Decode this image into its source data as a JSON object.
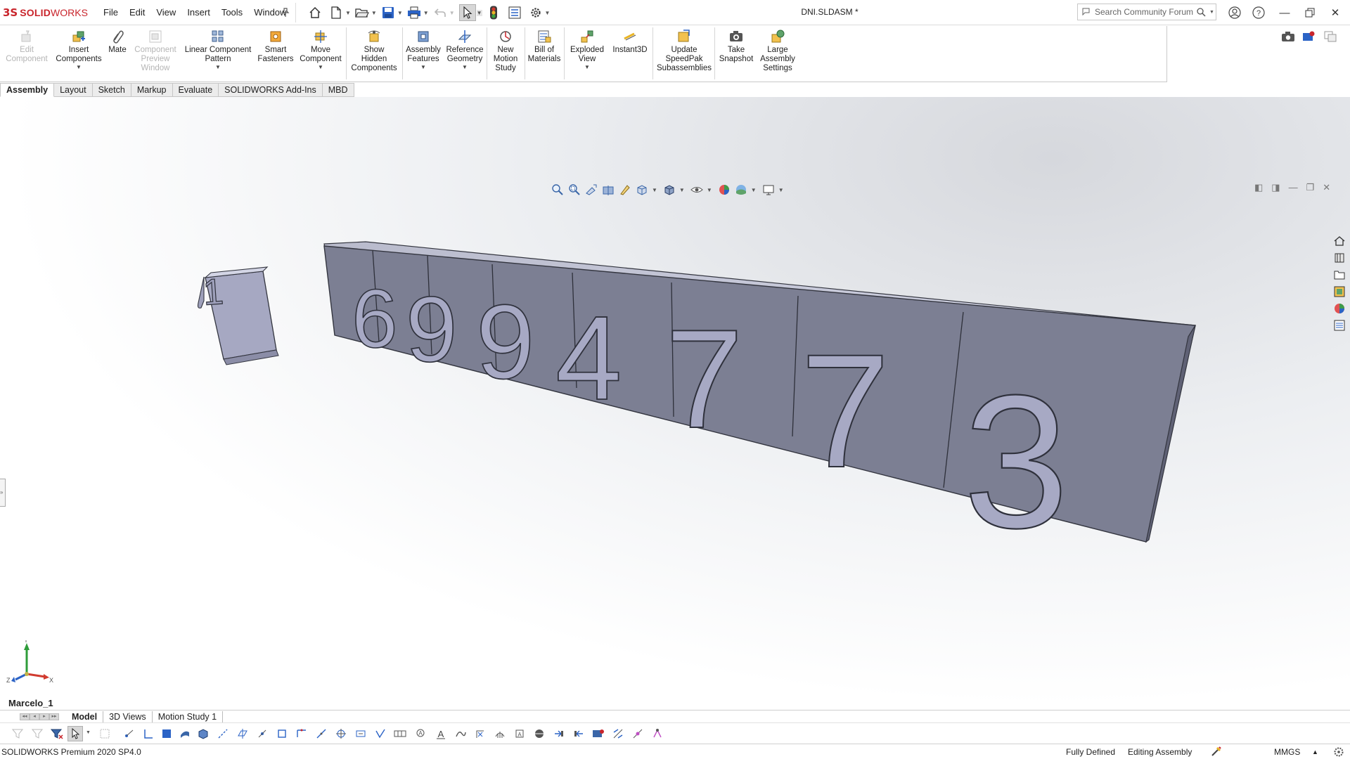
{
  "app": {
    "brand_ds": "3S",
    "brand_solid": "SOLID",
    "brand_works": "WORKS",
    "document_title": "DNI.SLDASM *"
  },
  "menu": [
    "File",
    "Edit",
    "View",
    "Insert",
    "Tools",
    "Window"
  ],
  "search": {
    "placeholder": "Search Community Forum"
  },
  "commands": [
    {
      "label": "Edit\nComponent",
      "enabled": false
    },
    {
      "label": "Insert\nComponents",
      "enabled": true
    },
    {
      "label": "Mate",
      "enabled": true
    },
    {
      "label": "Component\nPreview\nWindow",
      "enabled": false
    },
    {
      "label": "Linear Component\nPattern",
      "enabled": true
    },
    {
      "label": "Smart\nFasteners",
      "enabled": true
    },
    {
      "label": "Move\nComponent",
      "enabled": true
    },
    {
      "label": "Show\nHidden\nComponents",
      "enabled": true
    },
    {
      "label": "Assembly\nFeatures",
      "enabled": true
    },
    {
      "label": "Reference\nGeometry",
      "enabled": true
    },
    {
      "label": "New\nMotion\nStudy",
      "enabled": true
    },
    {
      "label": "Bill of\nMaterials",
      "enabled": true
    },
    {
      "label": "Exploded\nView",
      "enabled": true
    },
    {
      "label": "Instant3D",
      "enabled": true
    },
    {
      "label": "Update\nSpeedPak\nSubassemblies",
      "enabled": true
    },
    {
      "label": "Take\nSnapshot",
      "enabled": true
    },
    {
      "label": "Large\nAssembly\nSettings",
      "enabled": true
    }
  ],
  "command_tabs": [
    "Assembly",
    "Layout",
    "Sketch",
    "Markup",
    "Evaluate",
    "SOLIDWORKS Add-Ins",
    "MBD"
  ],
  "model": {
    "digits": [
      "1",
      "6",
      "9",
      "9",
      "4",
      "7",
      "7",
      "3"
    ],
    "face_color": "#7f8195",
    "top_color": "#c4c6d8",
    "digit_color": "#a9abc6"
  },
  "triad": {
    "x": "X",
    "y": "Y",
    "z": "Z"
  },
  "configuration": "Marcelo_1",
  "bottom_tabs": [
    "Model",
    "3D Views",
    "Motion Study 1"
  ],
  "status": {
    "product": "SOLIDWORKS Premium 2020 SP4.0",
    "definition": "Fully Defined",
    "mode": "Editing Assembly",
    "units": "MMGS",
    "units_arrow": "▲"
  },
  "colors": {
    "accent_red": "#c9252c",
    "toolbar_blue": "#2b63c6"
  }
}
